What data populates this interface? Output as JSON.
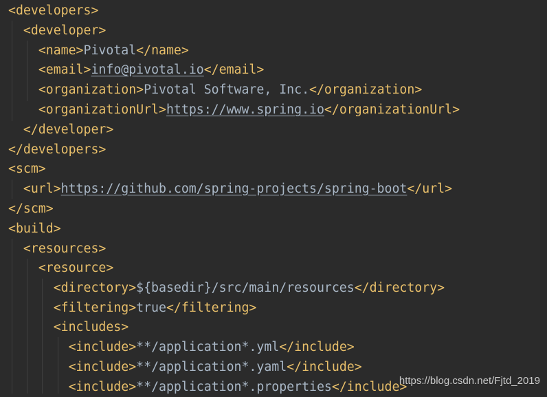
{
  "code": {
    "l1": {
      "open": "<developers>"
    },
    "l2": {
      "open": "<developer>"
    },
    "l3": {
      "open": "<name>",
      "value": "Pivotal",
      "close": "</name>"
    },
    "l4": {
      "open": "<email>",
      "value": "info@pivotal.io",
      "close": "</email>"
    },
    "l5": {
      "open": "<organization>",
      "value": "Pivotal Software, Inc.",
      "close": "</organization>"
    },
    "l6": {
      "open": "<organizationUrl>",
      "value": "https://www.spring.io",
      "close": "</organizationUrl>"
    },
    "l7": {
      "close": "</developer>"
    },
    "l8": {
      "close": "</developers>"
    },
    "l9": {
      "open": "<scm>"
    },
    "l10": {
      "open": "<url>",
      "value": "https://github.com/spring-projects/spring-boot",
      "close": "</url>"
    },
    "l11": {
      "close": "</scm>"
    },
    "l12": {
      "open": "<build>"
    },
    "l13": {
      "open": "<resources>"
    },
    "l14": {
      "open": "<resource>"
    },
    "l15": {
      "open": "<directory>",
      "value": "${basedir}/src/main/resources",
      "close": "</directory>"
    },
    "l16": {
      "open": "<filtering>",
      "value": "true",
      "close": "</filtering>"
    },
    "l17": {
      "open": "<includes>"
    },
    "l18": {
      "open": "<include>",
      "value": "**/application*.yml",
      "close": "</include>"
    },
    "l19": {
      "open": "<include>",
      "value": "**/application*.yaml",
      "close": "</include>"
    },
    "l20": {
      "open": "<include>",
      "value": "**/application*.properties",
      "close": "</include>"
    }
  },
  "colors": {
    "background": "#2b2b2b",
    "tag": "#e8bf6a",
    "text": "#a9b7c6"
  },
  "watermark": "https://blog.csdn.net/Fjtd_2019"
}
